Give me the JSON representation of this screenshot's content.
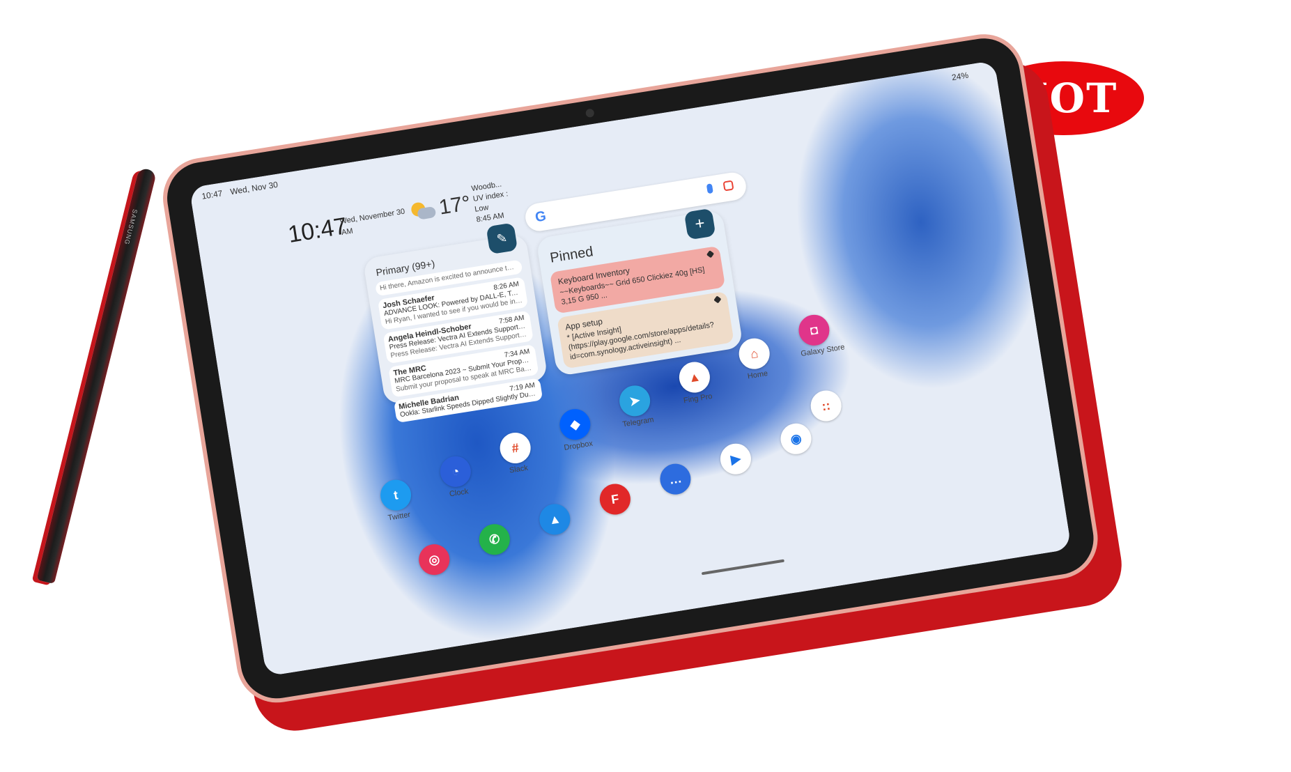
{
  "badge": {
    "label": "HOT",
    "color": "#e8090e"
  },
  "stylus": {
    "brand": "SAMSUNG"
  },
  "status_bar": {
    "time": "10:47",
    "date": "Wed, Nov 30",
    "battery": "24%"
  },
  "clock_widget": {
    "time": "10:47",
    "date_line1": "Wed, November 30",
    "date_line2": "AM"
  },
  "weather_widget": {
    "temperature": "17°",
    "location": "Woodb...",
    "uv_line1": "UV index :",
    "uv_line2": "Low",
    "updated": "8:45 AM"
  },
  "gmail_widget": {
    "header": "Primary (99+)",
    "top_snippet": "Hi there, Amazon is excited to announce tha...",
    "emails": [
      {
        "from": "Josh Schaefer",
        "time": "8:26 AM",
        "subject": "ADVANCE LOOK: Powered by DALL-E, Tech ...",
        "snippet": "Hi Ryan, I wanted to see if you would be inte..."
      },
      {
        "from": "Angela Heindl-Schober",
        "time": "7:58 AM",
        "subject": "Press Release: Vectra AI Extends Support fo...",
        "snippet": "Press Release: Vectra AI Extends Support fo..."
      },
      {
        "from": "The MRC",
        "time": "7:34 AM",
        "subject": "MRC Barcelona 2023 ~ Submit Your Proposa...",
        "snippet": "Submit your proposal to speak at MRC Barc..."
      },
      {
        "from": "Michelle Badrian",
        "time": "7:19 AM",
        "subject": "Ookla: Starlink Speeds Dipped Slightly Durin...",
        "snippet": ""
      }
    ]
  },
  "keep_widget": {
    "header": "Pinned",
    "notes": [
      {
        "title": "Keyboard Inventory",
        "body": "~~Keyboards~~ Grid 650 Clickiez 40g [HS] 3,15 G 950 ..."
      },
      {
        "title": "App setup",
        "body": "* [Active Insight](https://play.google.com/store/apps/details?id=com.synology.activeinsight) ..."
      }
    ]
  },
  "apps": [
    {
      "label": "Twitter",
      "color": "#1d9bf0",
      "glyph": "t"
    },
    {
      "label": "Clock",
      "color": "#2b5fd9",
      "glyph": "◔"
    },
    {
      "label": "Slack",
      "color": "#ffffff",
      "glyph": "#"
    },
    {
      "label": "Dropbox",
      "color": "#0061fe",
      "glyph": "◆"
    },
    {
      "label": "Telegram",
      "color": "#2aa3e0",
      "glyph": "➤"
    },
    {
      "label": "Fing Pro",
      "color": "#ffffff",
      "glyph": "▲"
    },
    {
      "label": "Home",
      "color": "#ffffff",
      "glyph": "⌂"
    },
    {
      "label": "Galaxy Store",
      "color": "#e0358a",
      "glyph": "◘"
    },
    {
      "label": "",
      "color": "#ffffff",
      "glyph": "::"
    }
  ],
  "dock_apps": [
    {
      "name": "camera",
      "color": "#e8335a",
      "glyph": "◎"
    },
    {
      "name": "phone",
      "color": "#24b24a",
      "glyph": "✆"
    },
    {
      "name": "kiwi",
      "color": "#1e88e5",
      "glyph": "▲"
    },
    {
      "name": "flipboard",
      "color": "#e12828",
      "glyph": "F"
    },
    {
      "name": "messages",
      "color": "#2d6cdf",
      "glyph": "…"
    },
    {
      "name": "play-store",
      "color": "#ffffff",
      "glyph": "▶"
    },
    {
      "name": "chrome",
      "color": "#ffffff",
      "glyph": "◉"
    }
  ]
}
